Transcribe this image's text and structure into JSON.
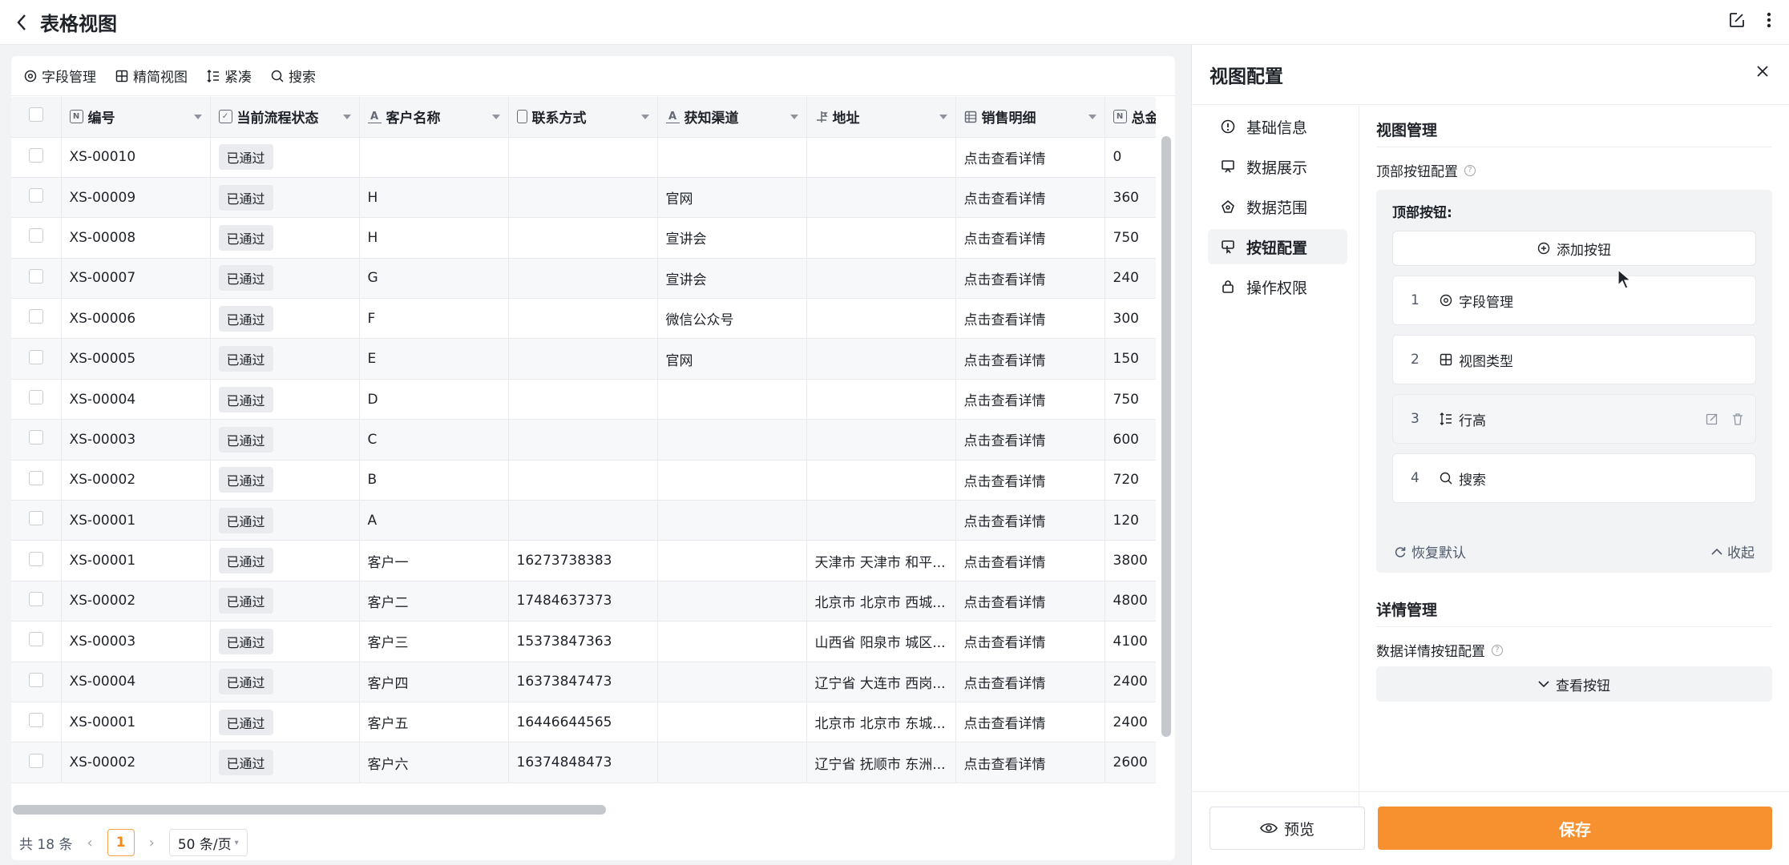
{
  "header": {
    "title": "表格视图"
  },
  "toolbar": {
    "field_manage": "字段管理",
    "simple_view": "精简视图",
    "row_height": "紧凑",
    "search": "搜索"
  },
  "table": {
    "columns": [
      {
        "label": "编号",
        "type": "N"
      },
      {
        "label": "当前流程状态",
        "type": "check"
      },
      {
        "label": "客户名称",
        "type": "A"
      },
      {
        "label": "联系方式",
        "type": "phone"
      },
      {
        "label": "获知渠道",
        "type": "A"
      },
      {
        "label": "地址",
        "type": "pin"
      },
      {
        "label": "销售明细",
        "type": "grid"
      },
      {
        "label": "总金额",
        "type": "N"
      }
    ],
    "rows": [
      [
        "XS-00010",
        "已通过",
        "",
        "",
        "",
        "",
        "点击查看详情",
        "0"
      ],
      [
        "XS-00009",
        "已通过",
        "H",
        "",
        "官网",
        "",
        "点击查看详情",
        "360"
      ],
      [
        "XS-00008",
        "已通过",
        "H",
        "",
        "宣讲会",
        "",
        "点击查看详情",
        "750"
      ],
      [
        "XS-00007",
        "已通过",
        "G",
        "",
        "宣讲会",
        "",
        "点击查看详情",
        "240"
      ],
      [
        "XS-00006",
        "已通过",
        "F",
        "",
        "微信公众号",
        "",
        "点击查看详情",
        "300"
      ],
      [
        "XS-00005",
        "已通过",
        "E",
        "",
        "官网",
        "",
        "点击查看详情",
        "150"
      ],
      [
        "XS-00004",
        "已通过",
        "D",
        "",
        "",
        "",
        "点击查看详情",
        "750"
      ],
      [
        "XS-00003",
        "已通过",
        "C",
        "",
        "",
        "",
        "点击查看详情",
        "600"
      ],
      [
        "XS-00002",
        "已通过",
        "B",
        "",
        "",
        "",
        "点击查看详情",
        "720"
      ],
      [
        "XS-00001",
        "已通过",
        "A",
        "",
        "",
        "",
        "点击查看详情",
        "120"
      ],
      [
        "XS-00001",
        "已通过",
        "客户一",
        "16273738383",
        "",
        "天津市 天津市 和平...",
        "点击查看详情",
        "3800"
      ],
      [
        "XS-00002",
        "已通过",
        "客户二",
        "17484637373",
        "",
        "北京市 北京市 西城...",
        "点击查看详情",
        "4800"
      ],
      [
        "XS-00003",
        "已通过",
        "客户三",
        "15373847363",
        "",
        "山西省 阳泉市 城区...",
        "点击查看详情",
        "4100"
      ],
      [
        "XS-00004",
        "已通过",
        "客户四",
        "16373847473",
        "",
        "辽宁省 大连市 西岗...",
        "点击查看详情",
        "2400"
      ],
      [
        "XS-00001",
        "已通过",
        "客户五",
        "16446644565",
        "",
        "北京市 北京市 东城...",
        "点击查看详情",
        "2400"
      ],
      [
        "XS-00002",
        "已通过",
        "客户六",
        "16374848473",
        "",
        "辽宁省 抚顺市 东洲...",
        "点击查看详情",
        "2600"
      ]
    ]
  },
  "pager": {
    "total": "共 18 条",
    "page": "1",
    "page_size": "50 条/页"
  },
  "drawer": {
    "title": "视图配置",
    "menu": [
      "基础信息",
      "数据展示",
      "数据范围",
      "按钮配置",
      "操作权限"
    ],
    "view_manage_title": "视图管理",
    "top_btn_config": "顶部按钮配置",
    "top_btn_label": "顶部按钮:",
    "add_btn": "添加按钮",
    "buttons": [
      {
        "index": "1",
        "label": "字段管理"
      },
      {
        "index": "2",
        "label": "视图类型"
      },
      {
        "index": "3",
        "label": "行高"
      },
      {
        "index": "4",
        "label": "搜索"
      }
    ],
    "restore": "恢复默认",
    "collapse": "收起",
    "detail_title": "详情管理",
    "detail_btn_config": "数据详情按钮配置",
    "view_btn": "查看按钮",
    "preview": "预览",
    "save": "保存"
  },
  "colors": {
    "accent": "#f7902e",
    "tag_bg": "#eaebee"
  }
}
